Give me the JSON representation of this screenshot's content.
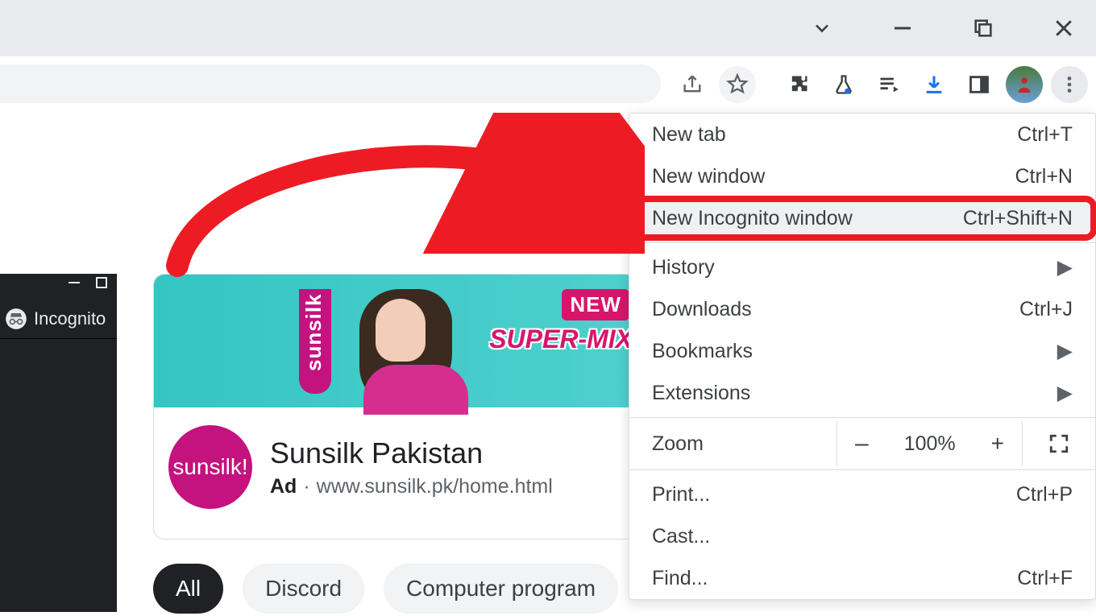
{
  "window": {
    "tab_dropdown_icon": "chevron-down",
    "min_label": "minimize",
    "max_label": "maximize",
    "close_label": "close"
  },
  "toolbar": {
    "install_icon": "install-app",
    "share_icon": "share",
    "star_icon": "bookmark-star",
    "ext_icon": "extensions-puzzle",
    "labs_icon": "chrome-labs",
    "media_icon": "media-queue",
    "downloads_icon": "downloads",
    "sidepanel_icon": "side-panel",
    "profile_icon": "profile-avatar",
    "more_icon": "overflow-menu"
  },
  "mini_window": {
    "tab_label": "Incognito"
  },
  "ad": {
    "banner_brand": "sunsilk",
    "banner_new": "NEW",
    "banner_supermix": "SUPER-MIX",
    "logo_text": "sunsilk!",
    "title": "Sunsilk Pakistan",
    "ad_label": "Ad",
    "url": "www.sunsilk.pk/home.html"
  },
  "chips": {
    "all": "All",
    "discord": "Discord",
    "compprog": "Computer program"
  },
  "menu": {
    "new_tab": {
      "label": "New tab",
      "shortcut": "Ctrl+T"
    },
    "new_window": {
      "label": "New window",
      "shortcut": "Ctrl+N"
    },
    "new_incognito": {
      "label": "New Incognito window",
      "shortcut": "Ctrl+Shift+N"
    },
    "history": {
      "label": "History"
    },
    "downloads": {
      "label": "Downloads",
      "shortcut": "Ctrl+J"
    },
    "bookmarks": {
      "label": "Bookmarks"
    },
    "extensions": {
      "label": "Extensions"
    },
    "zoom": {
      "label": "Zoom",
      "value": "100%",
      "minus": "–",
      "plus": "+"
    },
    "print": {
      "label": "Print...",
      "shortcut": "Ctrl+P"
    },
    "cast": {
      "label": "Cast..."
    },
    "find": {
      "label": "Find...",
      "shortcut": "Ctrl+F"
    }
  }
}
